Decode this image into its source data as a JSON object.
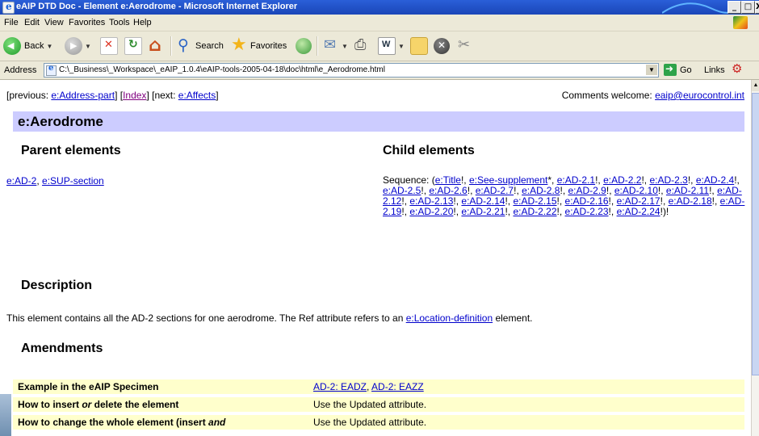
{
  "window": {
    "title": "eAIP DTD Doc - Element e:Aerodrome - Microsoft Internet Explorer",
    "controls": [
      "_",
      "□",
      "X"
    ]
  },
  "menu": [
    "File",
    "Edit",
    "View",
    "Favorites",
    "Tools",
    "Help"
  ],
  "toolbar": {
    "back": "Back",
    "search": "Search",
    "favorites": "Favorites"
  },
  "address": {
    "label": "Address",
    "url": "C:\\_Business\\_Workspace\\_eAIP_1.0.4\\eAIP-tools-2005-04-18\\doc\\html\\e_Aerodrome.html",
    "go": "Go",
    "links": "Links"
  },
  "page": {
    "nav": {
      "prefix": "[previous: ",
      "previous": "e:Address-part",
      "mid1": "] [",
      "index": "Index",
      "mid2": "] [next: ",
      "next": "e:Affects",
      "suffix": "]"
    },
    "comments": {
      "label": "Comments welcome: ",
      "email": "eaip@eurocontrol.int"
    },
    "title": "e:Aerodrome",
    "parent_heading": "Parent elements",
    "parents": [
      "e:AD-2",
      "e:SUP-section"
    ],
    "child_heading": "Child elements",
    "children": {
      "prefix": "Sequence: (",
      "items": [
        {
          "name": "e:Title",
          "suffix": "!"
        },
        {
          "name": "e:See-supplement",
          "suffix": "*"
        },
        {
          "name": "e:AD-2.1",
          "suffix": "!"
        },
        {
          "name": "e:AD-2.2",
          "suffix": "!"
        },
        {
          "name": "e:AD-2.3",
          "suffix": "!"
        },
        {
          "name": "e:AD-2.4",
          "suffix": "!"
        },
        {
          "name": "e:AD-2.5",
          "suffix": "!"
        },
        {
          "name": "e:AD-2.6",
          "suffix": "!"
        },
        {
          "name": "e:AD-2.7",
          "suffix": "!"
        },
        {
          "name": "e:AD-2.8",
          "suffix": "!"
        },
        {
          "name": "e:AD-2.9",
          "suffix": "!"
        },
        {
          "name": "e:AD-2.10",
          "suffix": "!"
        },
        {
          "name": "e:AD-2.11",
          "suffix": "!"
        },
        {
          "name": "e:AD-2.12",
          "suffix": "!"
        },
        {
          "name": "e:AD-2.13",
          "suffix": "!"
        },
        {
          "name": "e:AD-2.14",
          "suffix": "!"
        },
        {
          "name": "e:AD-2.15",
          "suffix": "!"
        },
        {
          "name": "e:AD-2.16",
          "suffix": "!"
        },
        {
          "name": "e:AD-2.17",
          "suffix": "!"
        },
        {
          "name": "e:AD-2.18",
          "suffix": "!"
        },
        {
          "name": "e:AD-2.19",
          "suffix": "!"
        },
        {
          "name": "e:AD-2.20",
          "suffix": "!"
        },
        {
          "name": "e:AD-2.21",
          "suffix": "!"
        },
        {
          "name": "e:AD-2.22",
          "suffix": "!"
        },
        {
          "name": "e:AD-2.23",
          "suffix": "!"
        },
        {
          "name": "e:AD-2.24",
          "suffix": "!"
        }
      ],
      "suffix": ")!"
    },
    "description_heading": "Description",
    "description": {
      "text": "This element contains all the AD-2 sections for one aerodrome. The Ref attribute refers to an ",
      "link": "e:Location-definition",
      "after": " element."
    },
    "amendments_heading": "Amendments",
    "amendments": [
      {
        "key": "Example in the eAIP Specimen",
        "links": [
          "AD-2: EADZ",
          "AD-2: EAZZ"
        ]
      },
      {
        "key_parts": [
          "How to insert ",
          "or",
          " delete the element"
        ],
        "value": "Use the Updated attribute."
      },
      {
        "key_parts": [
          "How to change the whole element (insert ",
          "and",
          ""
        ],
        "value": "Use the Updated attribute."
      }
    ]
  },
  "colors": {
    "titlebar": "#1a46b8",
    "chrome": "#ece9d8",
    "heading_bar": "#ccccff",
    "amend_row": "#ffffcc",
    "link": "#0000cc",
    "visited_link": "#800080"
  }
}
